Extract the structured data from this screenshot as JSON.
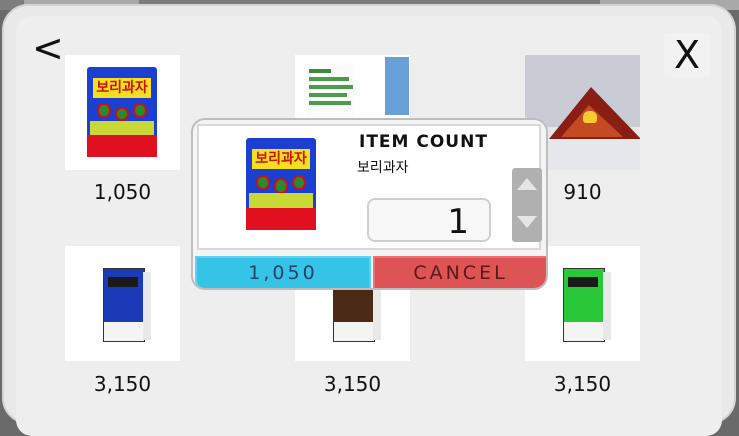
{
  "nav": {
    "back_label": "<",
    "close_label": "X"
  },
  "items": [
    {
      "name": "보리과자",
      "price": "1,050"
    },
    {
      "name": "",
      "price": ""
    },
    {
      "name": "",
      "price": "910"
    },
    {
      "name": "",
      "price": "3,150"
    },
    {
      "name": "",
      "price": "3,150"
    },
    {
      "name": "",
      "price": "3,150"
    }
  ],
  "thumb_text": {
    "snack_label": "보리과자"
  },
  "modal": {
    "title": "ITEM COUNT",
    "item_name": "보리과자",
    "count": "1",
    "buy_label": "1,050",
    "cancel_label": "CANCEL"
  },
  "colors": {
    "buy": "#36c3e8",
    "cancel": "#de5353"
  }
}
